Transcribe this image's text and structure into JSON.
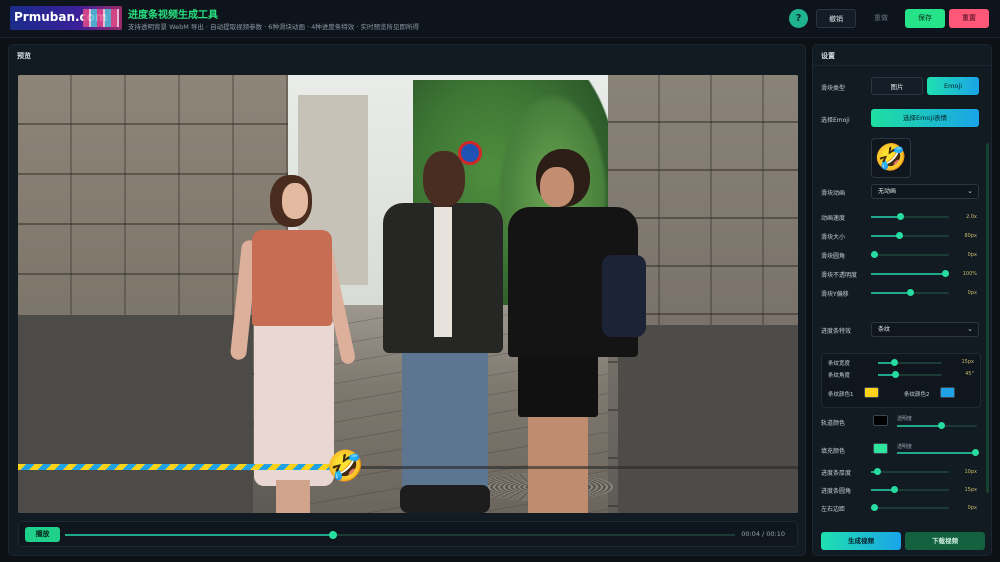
{
  "header": {
    "logo_text": "Prmuban.com",
    "title": "进度条视频生成工具",
    "subtitle": "支持透明背景 WebM 导出 · 自动提取视频参数 · 6种滑块动画 · 4种进度条特效 · 实时预览所见即所得",
    "help_label": "?",
    "undo_label": "撤销",
    "redo_label": "重做",
    "save_label": "保存",
    "reset_label": "重置"
  },
  "preview": {
    "label": "预览",
    "progress": 0.42,
    "thumb_emoji": "🤣",
    "play_label": "播放",
    "seek": 0.4,
    "time": "00:04 / 00:10"
  },
  "settings": {
    "title": "设置",
    "slider_type_label": "滑块类型",
    "slider_type_options": [
      "图片",
      "Emoji"
    ],
    "slider_type_selected": "Emoji",
    "emoji_label": "选择Emoji",
    "emoji_pick_label": "选择Emoji表情",
    "emoji_preview": "🤣",
    "animation_label": "滑块动画",
    "animation_value": "无动画",
    "sliders": [
      {
        "label": "动画速度",
        "value": "2.0x",
        "level": 0.38
      },
      {
        "label": "滑块大小",
        "value": "80px",
        "level": 0.36
      },
      {
        "label": "滑块圆角",
        "value": "0px",
        "level": 0.05
      },
      {
        "label": "滑块不透明度",
        "value": "100%",
        "level": 0.95
      },
      {
        "label": "滑块Y偏移",
        "value": "0px",
        "level": 0.5
      }
    ],
    "effect_label": "进度条特效",
    "effect_value": "条纹",
    "stripe": {
      "width_label": "条纹宽度",
      "width_value": "15px",
      "width_level": 0.25,
      "angle_label": "条纹角度",
      "angle_value": "45°",
      "angle_level": 0.28,
      "color1_label": "条纹颜色1",
      "color1": "#ffd21a",
      "color2_label": "条纹颜色2",
      "color2": "#1fa3e6"
    },
    "track_color_label": "轨道颜色",
    "track_color": "#000000",
    "track_opacity_label": "透明度",
    "track_opacity_level": 0.55,
    "fill_color_label": "填充颜色",
    "fill_color": "#2ee59d",
    "fill_opacity_label": "透明度",
    "fill_opacity_level": 0.98,
    "extra_sliders": [
      {
        "label": "进度条厚度",
        "value": "10px",
        "level": 0.08
      },
      {
        "label": "进度条圆角",
        "value": "15px",
        "level": 0.3
      },
      {
        "label": "左右边距",
        "value": "0px",
        "level": 0.05
      }
    ],
    "generate_label": "生成视频",
    "download_label": "下载视频"
  },
  "colors": {
    "accent": "#26e38a",
    "danger": "#ff5777",
    "panel": "#121a22"
  }
}
